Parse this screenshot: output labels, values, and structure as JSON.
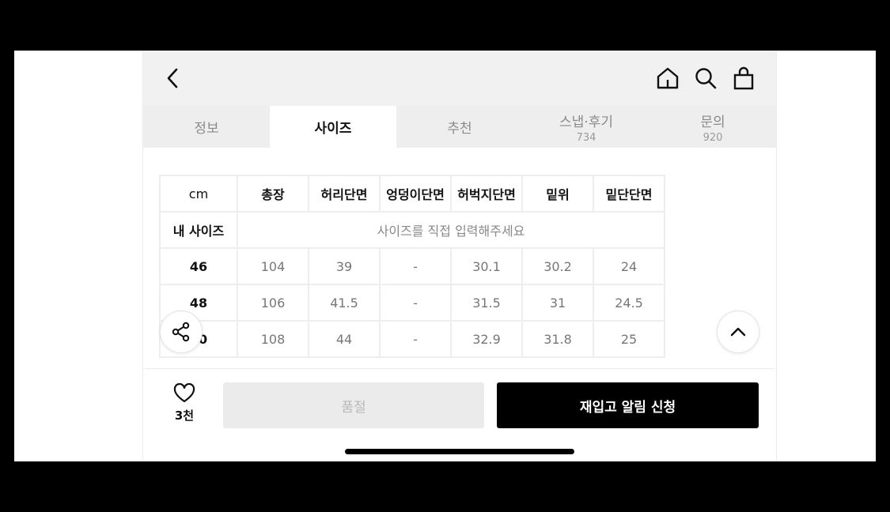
{
  "tabs": [
    {
      "label": "정보",
      "count": ""
    },
    {
      "label": "사이즈",
      "count": ""
    },
    {
      "label": "추천",
      "count": ""
    },
    {
      "label": "스냅·후기",
      "count": "734"
    },
    {
      "label": "문의",
      "count": "920"
    }
  ],
  "active_tab": 1,
  "size_table": {
    "unit": "cm",
    "columns": [
      "총장",
      "허리단면",
      "엉덩이단면",
      "허벅지단면",
      "밑위",
      "밑단단면"
    ],
    "my_size_label": "내 사이즈",
    "my_size_prompt": "사이즈를 직접 입력해주세요",
    "rows": [
      {
        "size": "46",
        "values": [
          "104",
          "39",
          "-",
          "30.1",
          "30.2",
          "24"
        ]
      },
      {
        "size": "48",
        "values": [
          "106",
          "41.5",
          "-",
          "31.5",
          "31",
          "24.5"
        ]
      },
      {
        "size": "50",
        "values": [
          "108",
          "44",
          "-",
          "32.9",
          "31.8",
          "25"
        ]
      }
    ]
  },
  "bottom_bar": {
    "like_count": "3천",
    "soldout_label": "품절",
    "restock_label": "재입고 알림 신청"
  },
  "icons": {
    "back": "chevron-left-icon",
    "home": "home-icon",
    "search": "search-icon",
    "cart": "shopping-bag-icon",
    "share": "share-icon",
    "scroll_top": "chevron-up-icon",
    "like": "heart-icon"
  }
}
